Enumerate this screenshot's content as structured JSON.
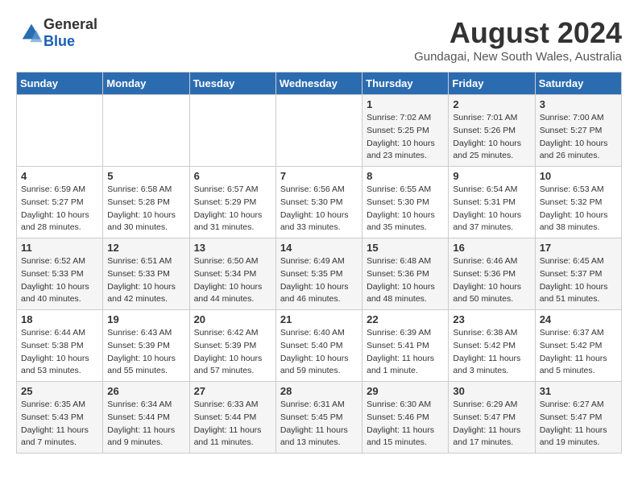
{
  "logo": {
    "general": "General",
    "blue": "Blue"
  },
  "title": {
    "month_year": "August 2024",
    "location": "Gundagai, New South Wales, Australia"
  },
  "days_of_week": [
    "Sunday",
    "Monday",
    "Tuesday",
    "Wednesday",
    "Thursday",
    "Friday",
    "Saturday"
  ],
  "weeks": [
    [
      {
        "day": "",
        "info": ""
      },
      {
        "day": "",
        "info": ""
      },
      {
        "day": "",
        "info": ""
      },
      {
        "day": "",
        "info": ""
      },
      {
        "day": "1",
        "info": "Sunrise: 7:02 AM\nSunset: 5:25 PM\nDaylight: 10 hours\nand 23 minutes."
      },
      {
        "day": "2",
        "info": "Sunrise: 7:01 AM\nSunset: 5:26 PM\nDaylight: 10 hours\nand 25 minutes."
      },
      {
        "day": "3",
        "info": "Sunrise: 7:00 AM\nSunset: 5:27 PM\nDaylight: 10 hours\nand 26 minutes."
      }
    ],
    [
      {
        "day": "4",
        "info": "Sunrise: 6:59 AM\nSunset: 5:27 PM\nDaylight: 10 hours\nand 28 minutes."
      },
      {
        "day": "5",
        "info": "Sunrise: 6:58 AM\nSunset: 5:28 PM\nDaylight: 10 hours\nand 30 minutes."
      },
      {
        "day": "6",
        "info": "Sunrise: 6:57 AM\nSunset: 5:29 PM\nDaylight: 10 hours\nand 31 minutes."
      },
      {
        "day": "7",
        "info": "Sunrise: 6:56 AM\nSunset: 5:30 PM\nDaylight: 10 hours\nand 33 minutes."
      },
      {
        "day": "8",
        "info": "Sunrise: 6:55 AM\nSunset: 5:30 PM\nDaylight: 10 hours\nand 35 minutes."
      },
      {
        "day": "9",
        "info": "Sunrise: 6:54 AM\nSunset: 5:31 PM\nDaylight: 10 hours\nand 37 minutes."
      },
      {
        "day": "10",
        "info": "Sunrise: 6:53 AM\nSunset: 5:32 PM\nDaylight: 10 hours\nand 38 minutes."
      }
    ],
    [
      {
        "day": "11",
        "info": "Sunrise: 6:52 AM\nSunset: 5:33 PM\nDaylight: 10 hours\nand 40 minutes."
      },
      {
        "day": "12",
        "info": "Sunrise: 6:51 AM\nSunset: 5:33 PM\nDaylight: 10 hours\nand 42 minutes."
      },
      {
        "day": "13",
        "info": "Sunrise: 6:50 AM\nSunset: 5:34 PM\nDaylight: 10 hours\nand 44 minutes."
      },
      {
        "day": "14",
        "info": "Sunrise: 6:49 AM\nSunset: 5:35 PM\nDaylight: 10 hours\nand 46 minutes."
      },
      {
        "day": "15",
        "info": "Sunrise: 6:48 AM\nSunset: 5:36 PM\nDaylight: 10 hours\nand 48 minutes."
      },
      {
        "day": "16",
        "info": "Sunrise: 6:46 AM\nSunset: 5:36 PM\nDaylight: 10 hours\nand 50 minutes."
      },
      {
        "day": "17",
        "info": "Sunrise: 6:45 AM\nSunset: 5:37 PM\nDaylight: 10 hours\nand 51 minutes."
      }
    ],
    [
      {
        "day": "18",
        "info": "Sunrise: 6:44 AM\nSunset: 5:38 PM\nDaylight: 10 hours\nand 53 minutes."
      },
      {
        "day": "19",
        "info": "Sunrise: 6:43 AM\nSunset: 5:39 PM\nDaylight: 10 hours\nand 55 minutes."
      },
      {
        "day": "20",
        "info": "Sunrise: 6:42 AM\nSunset: 5:39 PM\nDaylight: 10 hours\nand 57 minutes."
      },
      {
        "day": "21",
        "info": "Sunrise: 6:40 AM\nSunset: 5:40 PM\nDaylight: 10 hours\nand 59 minutes."
      },
      {
        "day": "22",
        "info": "Sunrise: 6:39 AM\nSunset: 5:41 PM\nDaylight: 11 hours\nand 1 minute."
      },
      {
        "day": "23",
        "info": "Sunrise: 6:38 AM\nSunset: 5:42 PM\nDaylight: 11 hours\nand 3 minutes."
      },
      {
        "day": "24",
        "info": "Sunrise: 6:37 AM\nSunset: 5:42 PM\nDaylight: 11 hours\nand 5 minutes."
      }
    ],
    [
      {
        "day": "25",
        "info": "Sunrise: 6:35 AM\nSunset: 5:43 PM\nDaylight: 11 hours\nand 7 minutes."
      },
      {
        "day": "26",
        "info": "Sunrise: 6:34 AM\nSunset: 5:44 PM\nDaylight: 11 hours\nand 9 minutes."
      },
      {
        "day": "27",
        "info": "Sunrise: 6:33 AM\nSunset: 5:44 PM\nDaylight: 11 hours\nand 11 minutes."
      },
      {
        "day": "28",
        "info": "Sunrise: 6:31 AM\nSunset: 5:45 PM\nDaylight: 11 hours\nand 13 minutes."
      },
      {
        "day": "29",
        "info": "Sunrise: 6:30 AM\nSunset: 5:46 PM\nDaylight: 11 hours\nand 15 minutes."
      },
      {
        "day": "30",
        "info": "Sunrise: 6:29 AM\nSunset: 5:47 PM\nDaylight: 11 hours\nand 17 minutes."
      },
      {
        "day": "31",
        "info": "Sunrise: 6:27 AM\nSunset: 5:47 PM\nDaylight: 11 hours\nand 19 minutes."
      }
    ]
  ]
}
